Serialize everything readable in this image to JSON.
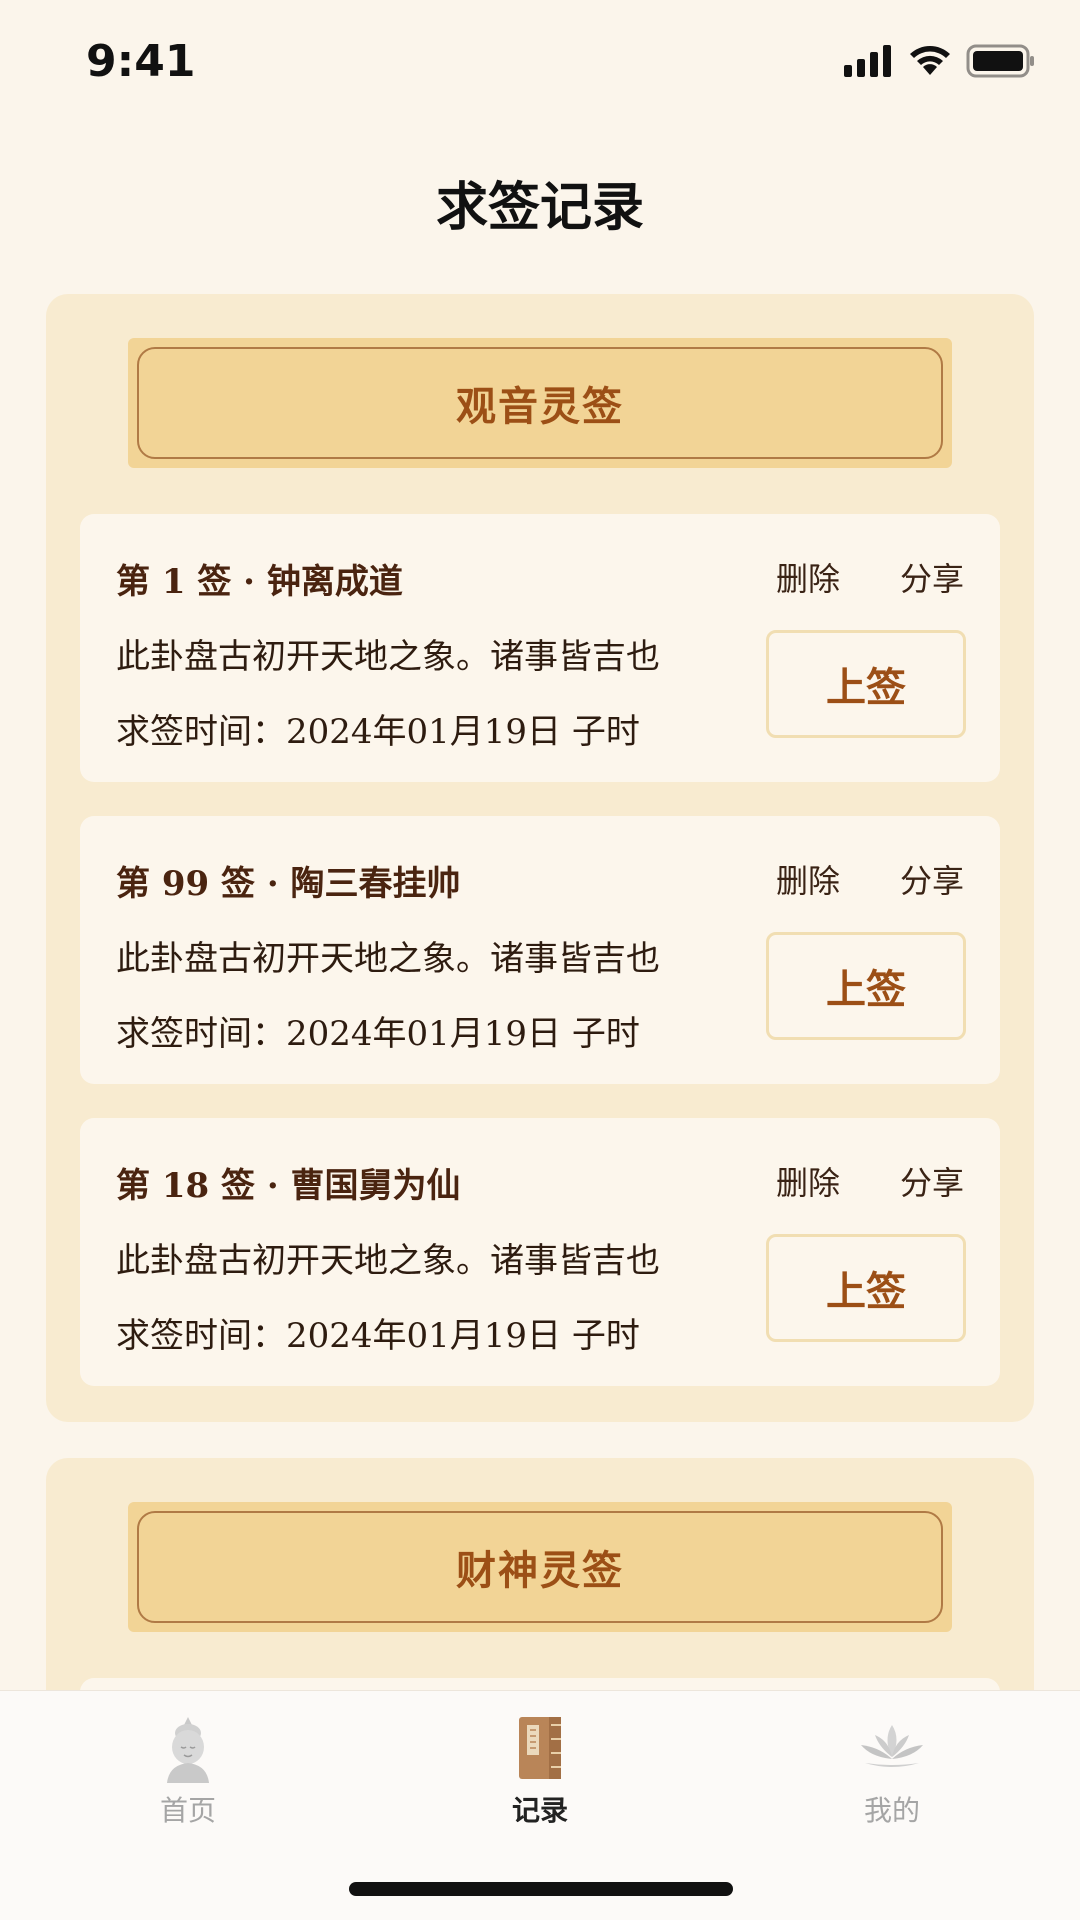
{
  "status_bar": {
    "time": "9:41"
  },
  "page": {
    "title": "求签记录"
  },
  "groups": [
    {
      "name": "观音灵签",
      "records": [
        {
          "title": "第 1 签 · 钟离成道",
          "description": "此卦盘古初开天地之象。诸事皆吉也",
          "time": "求签时间：2024年01月19日 子时",
          "level": "上签",
          "delete_label": "删除",
          "share_label": "分享"
        },
        {
          "title": "第 99 签 · 陶三春挂帅",
          "description": "此卦盘古初开天地之象。诸事皆吉也",
          "time": "求签时间：2024年01月19日 子时",
          "level": "上签",
          "delete_label": "删除",
          "share_label": "分享"
        },
        {
          "title": "第 18 签 · 曹国舅为仙",
          "description": "此卦盘古初开天地之象。诸事皆吉也",
          "time": "求签时间：2024年01月19日 子时",
          "level": "上签",
          "delete_label": "删除",
          "share_label": "分享"
        }
      ]
    },
    {
      "name": "财神灵签"
    }
  ],
  "tab_bar": {
    "tabs": [
      {
        "label": "首页",
        "icon": "buddha-icon",
        "active": false
      },
      {
        "label": "记录",
        "icon": "book-icon",
        "active": true
      },
      {
        "label": "我的",
        "icon": "lotus-icon",
        "active": false
      }
    ]
  },
  "colors": {
    "background": "#FBF5EB",
    "group_background": "#F8EBD0",
    "banner_fill": "#F2D496",
    "accent_brown": "#9C4F16",
    "title_brown": "#4A2410"
  }
}
